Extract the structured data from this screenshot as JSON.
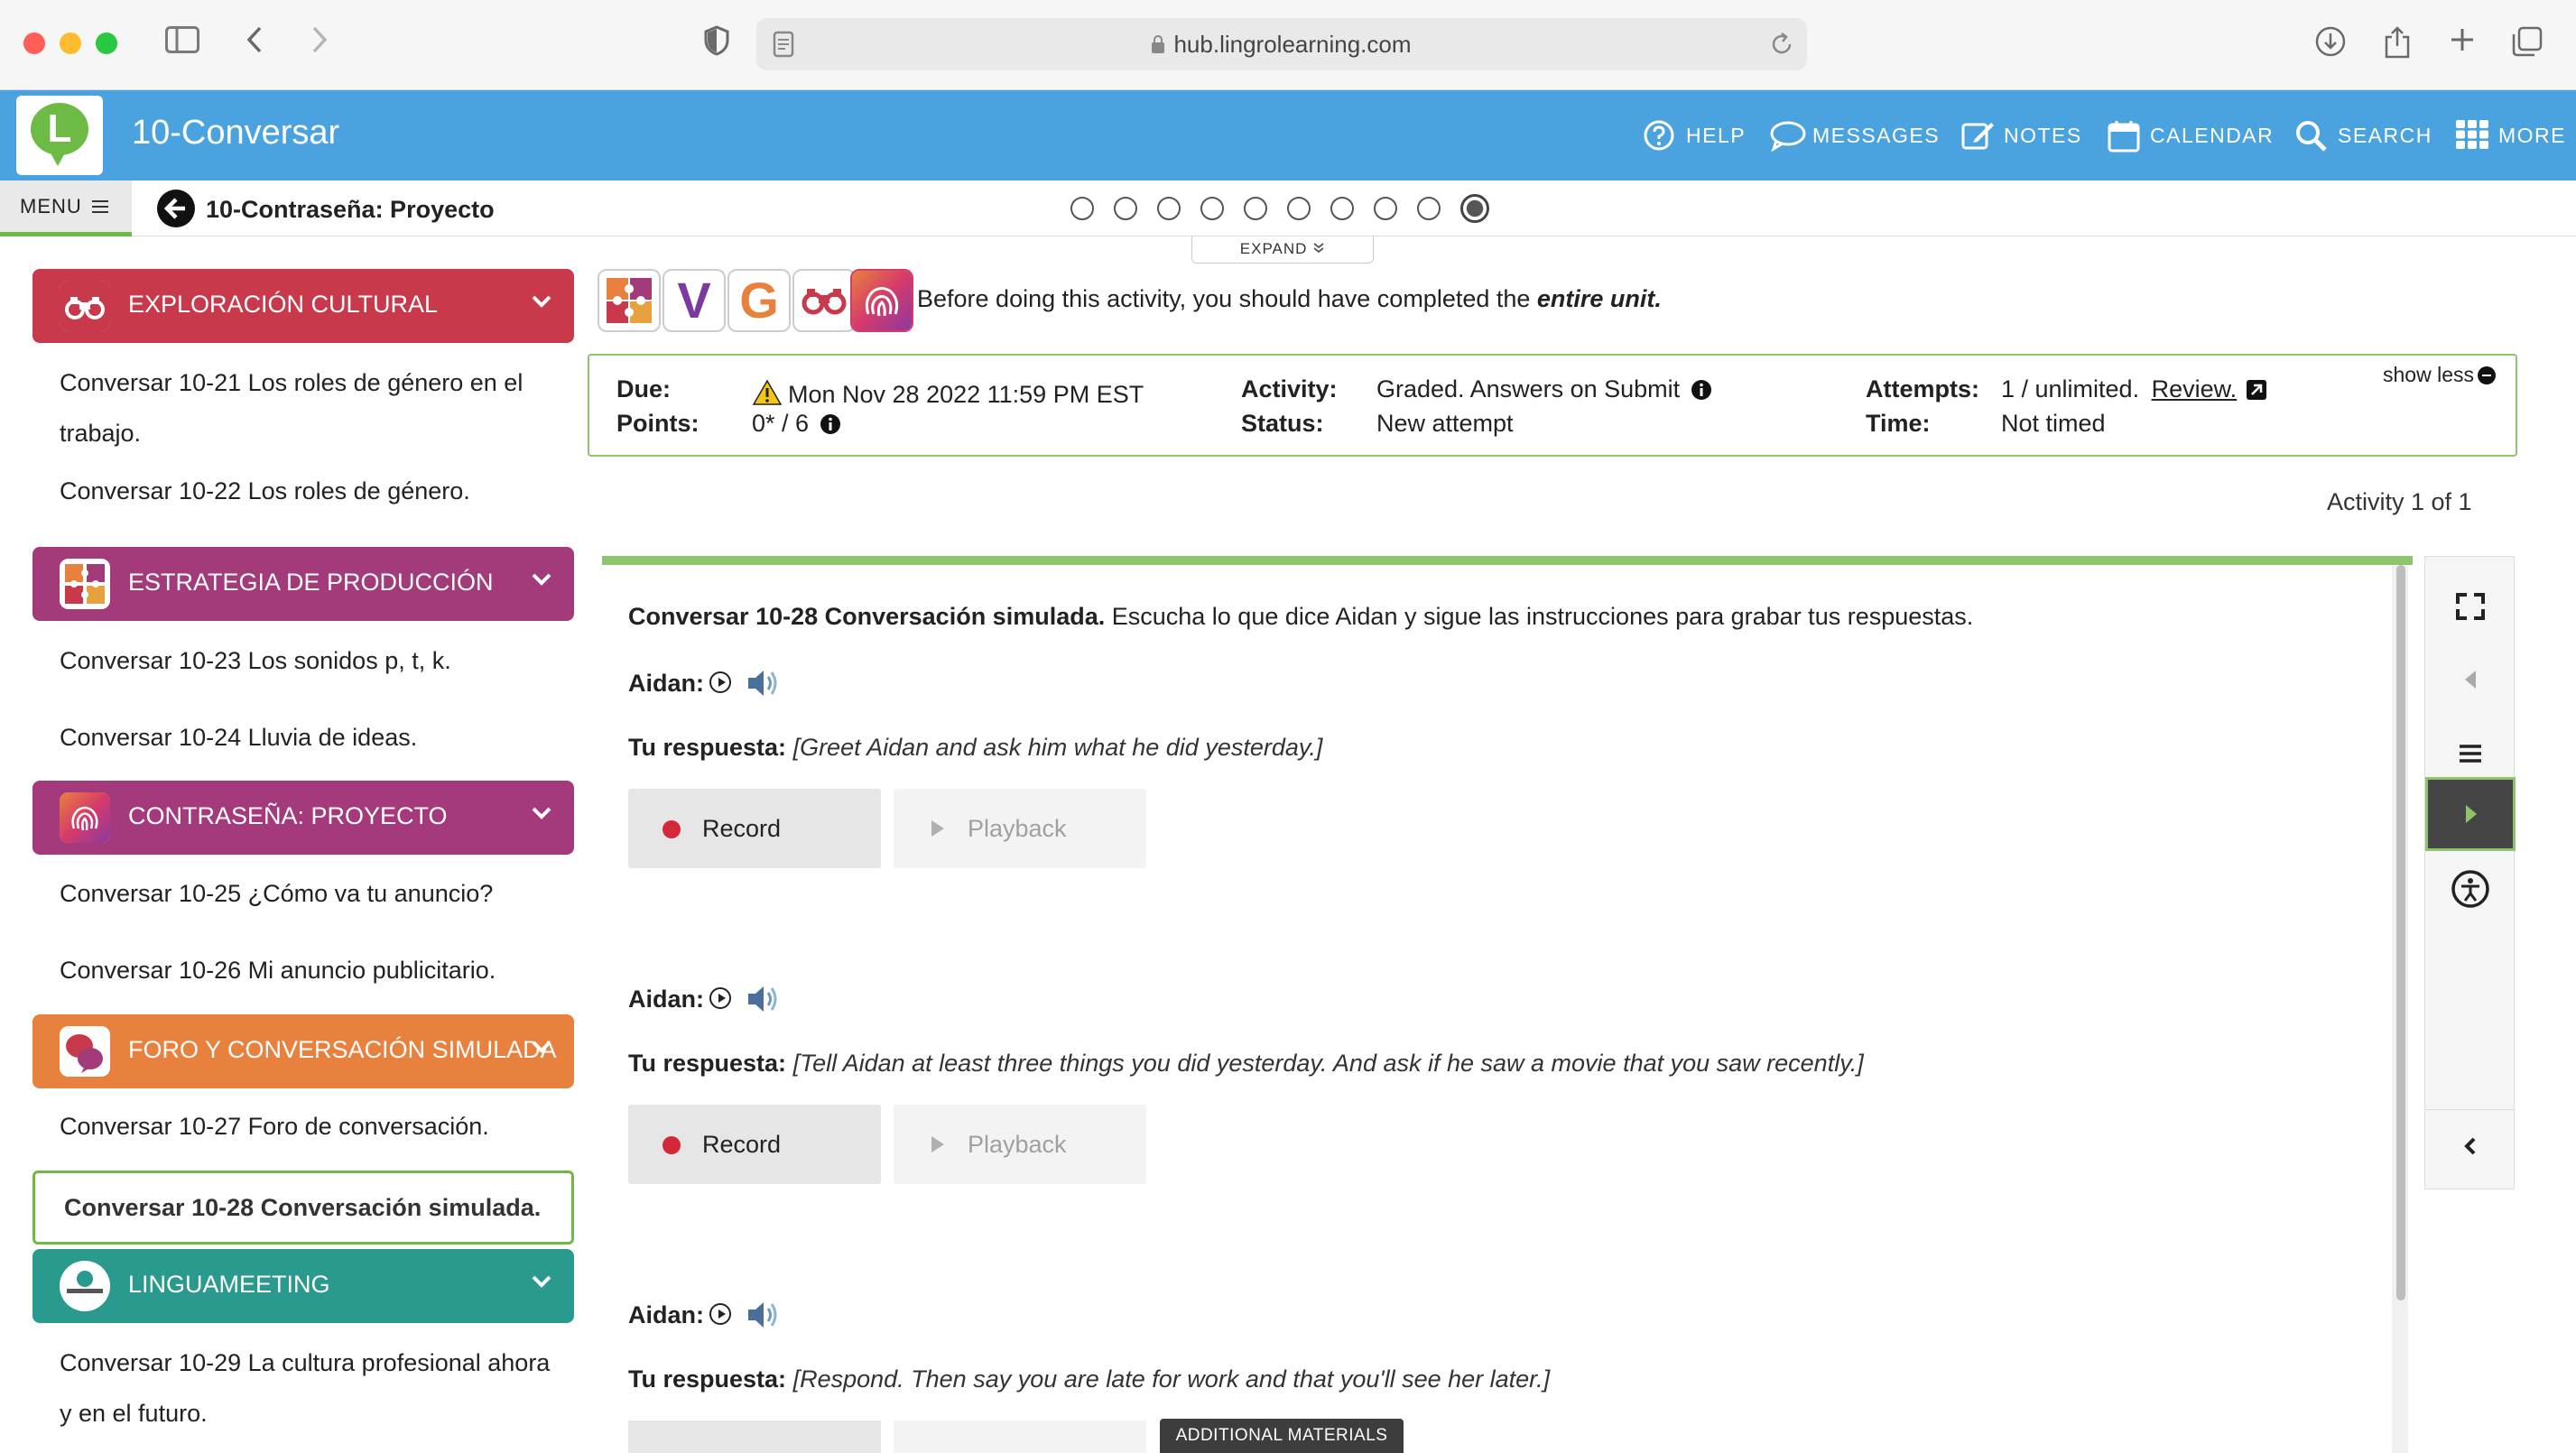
{
  "browser": {
    "url": "hub.lingrolearning.com"
  },
  "app": {
    "title": "10-Conversar",
    "logo_letter": "L",
    "nav": [
      {
        "label": "HELP",
        "icon": "help-icon"
      },
      {
        "label": "MESSAGES",
        "icon": "chat-bubble-icon"
      },
      {
        "label": "NOTES",
        "icon": "notes-edit-icon"
      },
      {
        "label": "CALENDAR",
        "icon": "calendar-icon"
      },
      {
        "label": "SEARCH",
        "icon": "search-icon"
      },
      {
        "label": "MORE",
        "icon": "grid-icon"
      }
    ]
  },
  "subbar": {
    "menu_label": "MENU",
    "page_title": "10-Contraseña: Proyecto",
    "progress_dots_total": 10,
    "progress_dots_active": 10,
    "expand_label": "EXPAND"
  },
  "sidebar": {
    "sections": [
      {
        "label": "EXPLORACIÓN CULTURAL",
        "icon": "binoculars-icon",
        "color": "#c8394c",
        "items": [
          "Conversar 10-21 Los roles de género en el trabajo.",
          "Conversar 10-22 Los roles de género."
        ]
      },
      {
        "label": "ESTRATEGIA DE PRODUCCIÓN",
        "icon": "puzzle-icon",
        "color": "#a33a7a",
        "items": [
          "Conversar 10-23 Los sonidos p, t, k.",
          "Conversar 10-24 Lluvia de ideas."
        ]
      },
      {
        "label": "CONTRASEÑA: PROYECTO",
        "icon": "fingerprint-icon",
        "color": "#a43a7c",
        "items": [
          "Conversar 10-25 ¿Cómo va tu anuncio?",
          "Conversar 10-26 Mi anuncio publicitario."
        ]
      },
      {
        "label": "FORO Y CONVERSACIÓN SIMULADA",
        "icon": "speech-bubbles-icon",
        "color": "#e8813d",
        "items": [
          "Conversar 10-27 Foro de conversación.",
          "Conversar 10-28 Conversación simulada."
        ]
      },
      {
        "label": "LINGUAMEETING",
        "icon": "linguameeting-icon",
        "color": "#2b9a8e",
        "items": [
          "Conversar 10-29 La cultura profesional ahora y en el futuro."
        ]
      }
    ]
  },
  "activity": {
    "badges": [
      "puzzle-icon",
      "V",
      "G",
      "binoculars-icon",
      "fingerprint-icon"
    ],
    "prereq_text": "Before doing this activity, you should have completed the ",
    "prereq_emph": "entire unit.",
    "due_label": "Due:",
    "due_value": "Mon Nov 28 2022 11:59 PM EST",
    "points_label": "Points:",
    "points_value": "0* / 6",
    "activity_label": "Activity:",
    "activity_value": "Graded. Answers on Submit",
    "status_label": "Status:",
    "status_value": "New attempt",
    "attempts_label": "Attempts:",
    "attempts_value": "1 / unlimited.",
    "review_label": "Review.",
    "time_label": "Time:",
    "time_value": "Not timed",
    "show_less": "show less",
    "count": "Activity 1 of 1"
  },
  "content": {
    "intro_title": "Conversar 10-28 Conversación simulada.",
    "intro_text": " Escucha lo que dice Aidan y sigue las instrucciones para grabar tus respuestas.",
    "speaker_label": "Aidan:",
    "response_label": "Tu respuesta:",
    "record_label": "Record",
    "playback_label": "Playback",
    "prompts": [
      "[Greet Aidan and ask him what he did yesterday.]",
      "[Tell Aidan at least three things you did yesterday. And ask if he saw a movie that you saw recently.]",
      "[Respond. Then say you are late for work and that you'll see her later.]"
    ]
  },
  "toolrail": [
    "fullscreen-icon",
    "prev-icon",
    "list-icon",
    "next-play-icon",
    "accessibility-icon",
    "collapse-icon"
  ],
  "footer": {
    "additional_materials": "ADDITIONAL MATERIALS"
  },
  "colors": {
    "appbar": "#4aa3df",
    "accent_green": "#8cc56b",
    "record_red": "#d3283a"
  }
}
